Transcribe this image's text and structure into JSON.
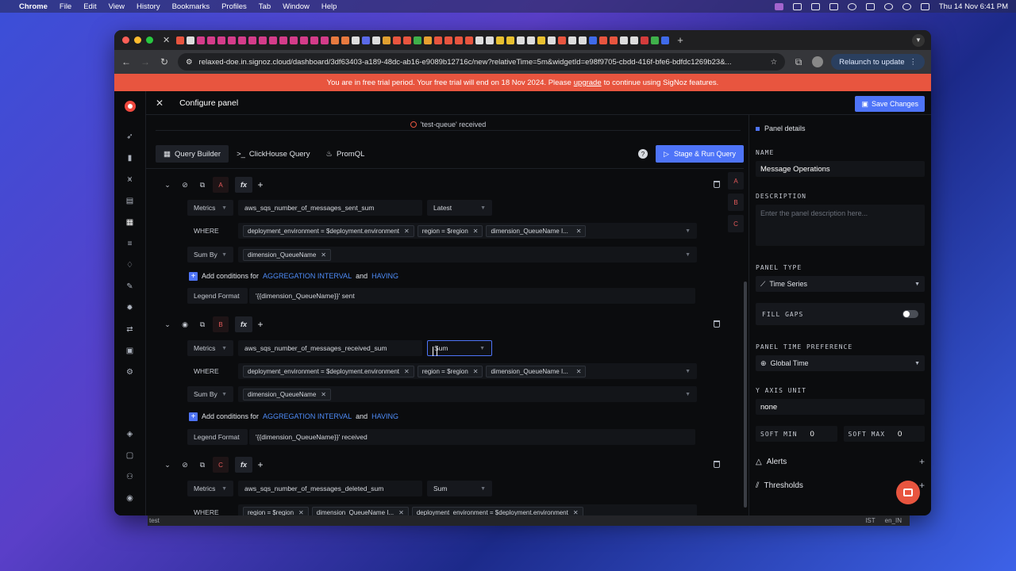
{
  "menubar": {
    "app": "Chrome",
    "items": [
      "File",
      "Edit",
      "View",
      "History",
      "Bookmarks",
      "Profiles",
      "Tab",
      "Window",
      "Help"
    ],
    "clock": "Thu 14 Nov  6:41 PM"
  },
  "browser": {
    "url": "relaxed-doe.in.signoz.cloud/dashboard/3df63403-a189-48dc-ab16-e9089b12716c/new?relativeTime=5m&widgetId=e98f9705-cbdd-416f-bfe6-bdfdc1269b23&...",
    "relaunch": "Relaunch to update"
  },
  "trial": {
    "before": "You are in free trial period. Your free trial will end on 18 Nov 2024. Please",
    "link": "upgrade",
    "after": "to continue using SigNoz features."
  },
  "header": {
    "title": "Configure panel",
    "save": "Save Changes"
  },
  "top_strip": "'test-queue' received",
  "query_tabs": [
    "Query Builder",
    "ClickHouse Query",
    "PromQL"
  ],
  "stage_run": "Stage & Run Query",
  "side_letters": [
    "A",
    "B",
    "C"
  ],
  "queries": {
    "a": {
      "letter": "A",
      "metrics_label": "Metrics",
      "metric": "aws_sqs_number_of_messages_sent_sum",
      "agg": "Latest",
      "where_label": "WHERE",
      "filters": [
        "deployment_environment = $deployment.environment",
        "region = $region",
        "dimension_QueueName I..."
      ],
      "sumby_label": "Sum By",
      "sumby": "dimension_QueueName",
      "cond_prefix": "Add conditions for",
      "cond_agg": "AGGREGATION INTERVAL",
      "cond_and": "and",
      "cond_having": "HAVING",
      "legend_label": "Legend Format",
      "legend": "'{{dimension_QueueName}}' sent"
    },
    "b": {
      "letter": "B",
      "metrics_label": "Metrics",
      "metric": "aws_sqs_number_of_messages_received_sum",
      "agg": "Sum",
      "where_label": "WHERE",
      "filters": [
        "deployment_environment = $deployment.environment",
        "region = $region",
        "dimension_QueueName I..."
      ],
      "sumby_label": "Sum By",
      "sumby": "dimension_QueueName",
      "cond_prefix": "Add conditions for",
      "cond_agg": "AGGREGATION INTERVAL",
      "cond_and": "and",
      "cond_having": "HAVING",
      "legend_label": "Legend Format",
      "legend": "'{{dimension_QueueName}}' received"
    },
    "c": {
      "letter": "C",
      "metrics_label": "Metrics",
      "metric": "aws_sqs_number_of_messages_deleted_sum",
      "agg": "Sum",
      "where_label": "WHERE",
      "filters": [
        "region = $region",
        "dimension_QueueName I...",
        "deployment_environment = $deployment.environment"
      ]
    }
  },
  "settings": {
    "section": "Panel details",
    "name_label": "NAME",
    "name": "Message Operations",
    "desc_label": "DESCRIPTION",
    "desc_placeholder": "Enter the panel description here...",
    "type_label": "PANEL TYPE",
    "type": "Time Series",
    "fill_gaps": "FILL GAPS",
    "time_pref_label": "PANEL TIME PREFERENCE",
    "time_pref": "Global Time",
    "y_unit_label": "Y AXIS UNIT",
    "y_unit": "none",
    "soft_min_label": "SOFT MIN",
    "soft_min": "0",
    "soft_max_label": "SOFT MAX",
    "soft_max": "0",
    "alerts": "Alerts",
    "thresholds": "Thresholds"
  },
  "statusbar": {
    "left": "test",
    "tz": "IST",
    "locale": "en_IN"
  },
  "colors": {
    "accent": "#4e74f8",
    "trial": "#e8553f",
    "query_letter": "#e55a5a"
  }
}
